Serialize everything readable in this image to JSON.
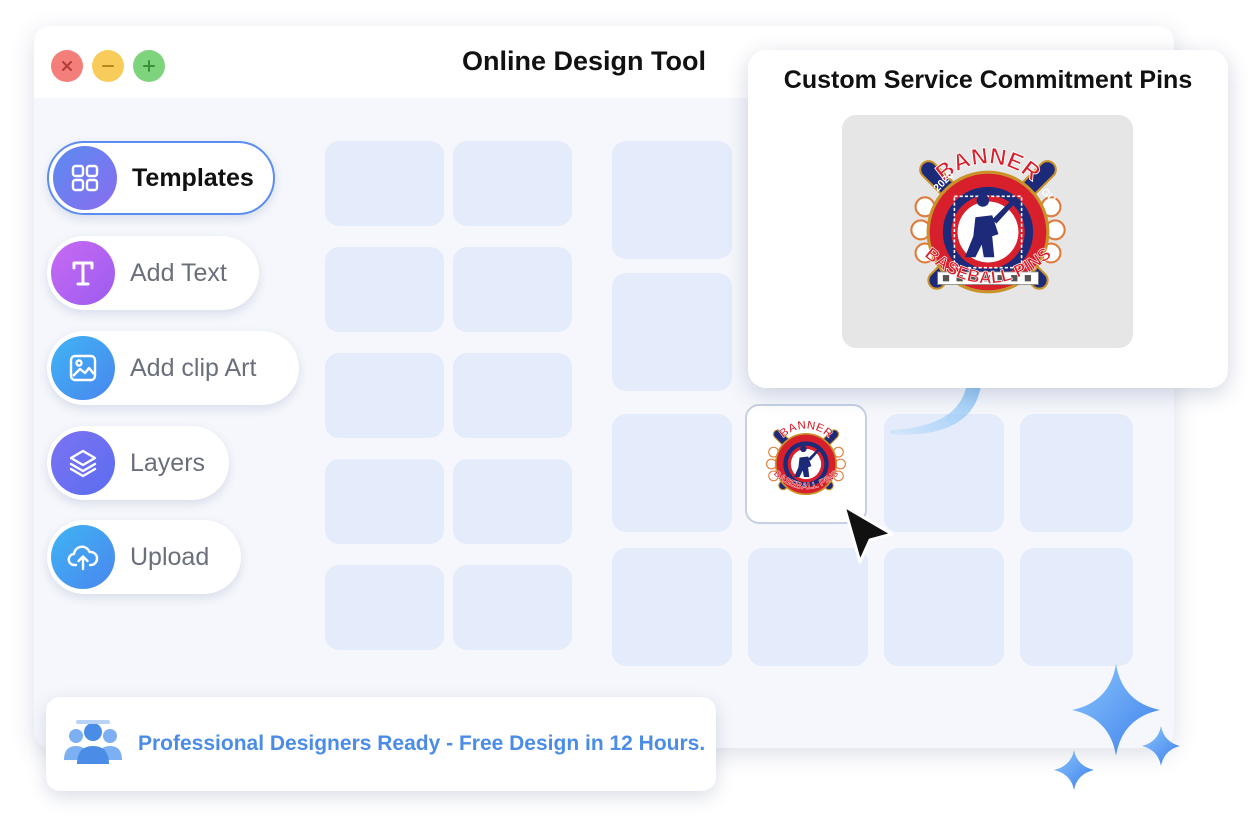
{
  "window": {
    "title": "Online Design Tool",
    "controls": [
      "close",
      "minimize",
      "maximize"
    ]
  },
  "sidebar": {
    "items": [
      {
        "label": "Templates",
        "icon": "grid-icon",
        "active": true,
        "icon_color": "#6a7ef0"
      },
      {
        "label": "Add Text",
        "icon": "text-icon",
        "active": false,
        "icon_color": "#b45ef2"
      },
      {
        "label": "Add clip Art",
        "icon": "image-icon",
        "active": false,
        "icon_color": "#3aa6f2"
      },
      {
        "label": "Layers",
        "icon": "layers-icon",
        "active": false,
        "icon_color": "#6b6ff0"
      },
      {
        "label": "Upload",
        "icon": "cloud-upload-icon",
        "active": false,
        "icon_color": "#3aa6f2"
      }
    ]
  },
  "popup": {
    "title": "Custom Service Commitment Pins",
    "pin": {
      "top_text": "BANNER",
      "bottom_text": "BASEBALL PINS",
      "left_tab": "2020",
      "right_tab": "GU"
    }
  },
  "selected_template": {
    "top_text": "BANNER",
    "bottom_text": "BASEBALL PINS"
  },
  "banner": {
    "text": "Professional Designers Ready - Free Design in 12 Hours."
  },
  "colors": {
    "accent": "#5b8ef0",
    "tile": "#e4ebfb",
    "banner_text": "#4b8de6",
    "pin_red": "#d8202c",
    "pin_navy": "#1d2a7a"
  }
}
